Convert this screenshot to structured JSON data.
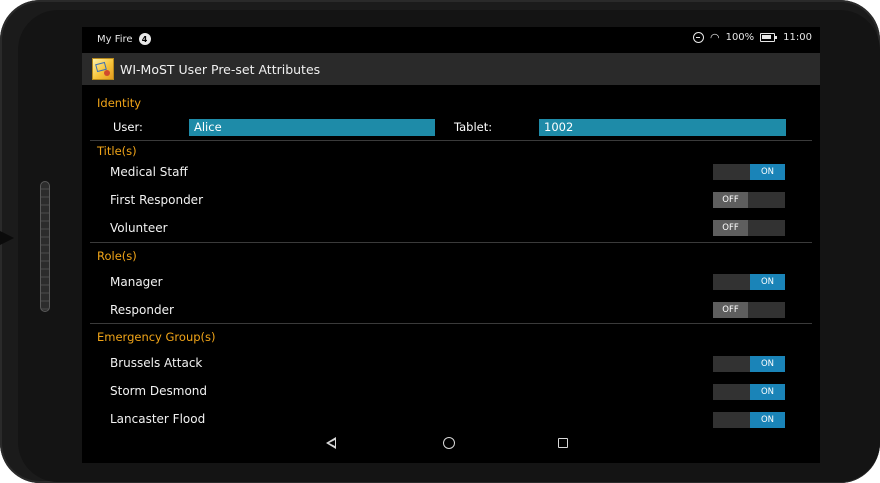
{
  "status_bar": {
    "device_name": "My Fire",
    "notification_count": "4",
    "battery": "100%",
    "time": "11:00"
  },
  "app": {
    "title": "WI-MoST User Pre-set Attributes"
  },
  "identity": {
    "header": "Identity",
    "user_label": "User:",
    "user_value": "Alice",
    "tablet_label": "Tablet:",
    "tablet_value": "1002"
  },
  "titles": {
    "header": "Title(s)",
    "items": [
      {
        "label": "Medical Staff",
        "state": "ON"
      },
      {
        "label": "First Responder",
        "state": "OFF"
      },
      {
        "label": "Volunteer",
        "state": "OFF"
      }
    ]
  },
  "roles": {
    "header": "Role(s)",
    "items": [
      {
        "label": "Manager",
        "state": "ON"
      },
      {
        "label": "Responder",
        "state": "OFF"
      }
    ]
  },
  "groups": {
    "header": "Emergency Group(s)",
    "items": [
      {
        "label": "Brussels Attack",
        "state": "ON"
      },
      {
        "label": "Storm Desmond",
        "state": "ON"
      },
      {
        "label": "Lancaster Flood",
        "state": "ON"
      }
    ]
  },
  "navigation": {
    "back": "back-icon",
    "home": "home-icon",
    "recents": "recents-icon"
  },
  "colors": {
    "section_header": "#f0a418",
    "input_background": "#1e8ba8",
    "toggle_on": "#1a84b8",
    "toggle_off": "#5e5e5e"
  }
}
